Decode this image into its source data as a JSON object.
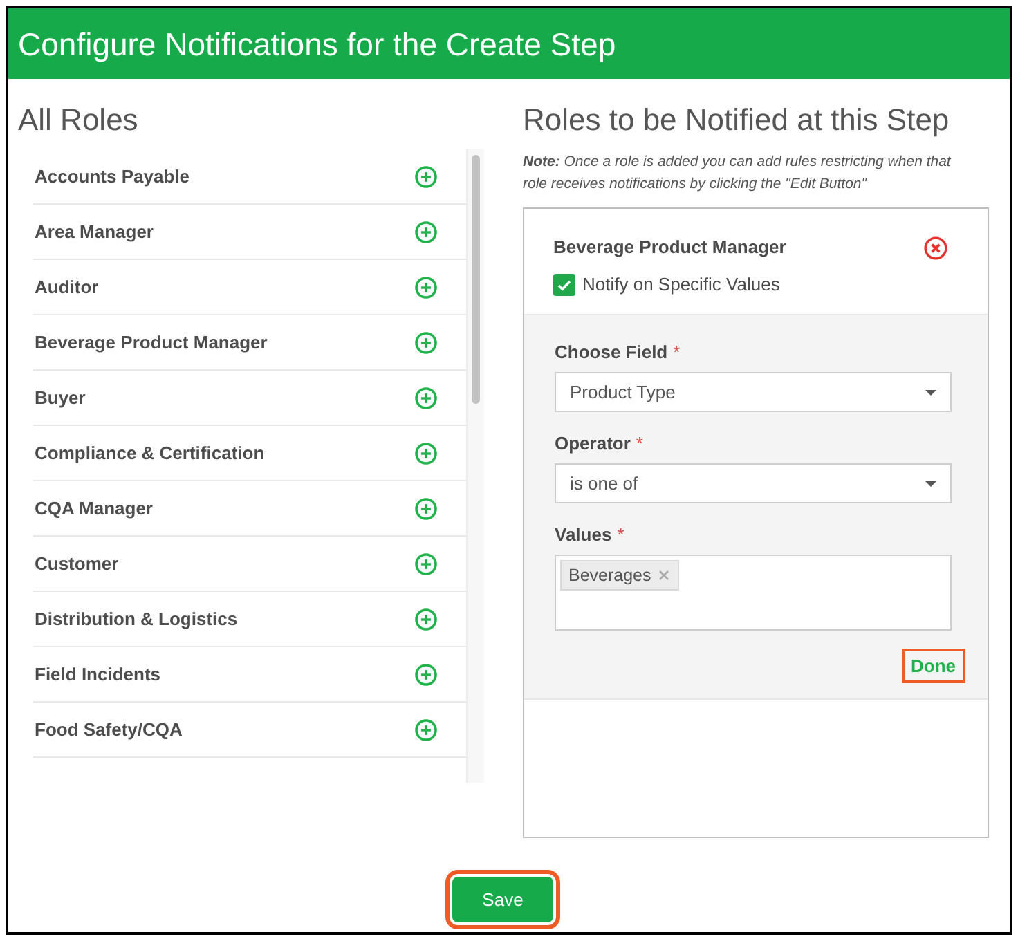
{
  "window": {
    "title": "Configure Notifications for the Create Step"
  },
  "all_roles": {
    "heading": "All Roles",
    "items": [
      {
        "label": "Accounts Payable"
      },
      {
        "label": "Area Manager"
      },
      {
        "label": "Auditor"
      },
      {
        "label": "Beverage Product Manager"
      },
      {
        "label": "Buyer"
      },
      {
        "label": "Compliance & Certification"
      },
      {
        "label": "CQA Manager"
      },
      {
        "label": "Customer"
      },
      {
        "label": "Distribution & Logistics"
      },
      {
        "label": "Field Incidents"
      },
      {
        "label": "Food Safety/CQA"
      }
    ]
  },
  "notified": {
    "heading": "Roles to be Notified at this Step",
    "note": "**Note:** Once a role is added you can add rules restricting when that role receives notifications by clicking the \"Edit Button\"",
    "roles": [
      {
        "name": "Beverage Product Manager",
        "notify_specific": {
          "label": "Notify on Specific Values",
          "checked": true
        },
        "fields": [
          {
            "kind": "select",
            "label": "Choose Field",
            "required_mark": "*",
            "value": "Product Type"
          },
          {
            "kind": "select",
            "label": "Operator",
            "required_mark": "*",
            "value": "is one of"
          },
          {
            "kind": "tags",
            "label": "Values",
            "required_mark": "*",
            "tags": [
              "Beverages"
            ]
          }
        ],
        "done": {
          "label": "Done",
          "highlighted": true
        }
      }
    ]
  },
  "save": {
    "label": "Save",
    "highlighted": true
  }
}
